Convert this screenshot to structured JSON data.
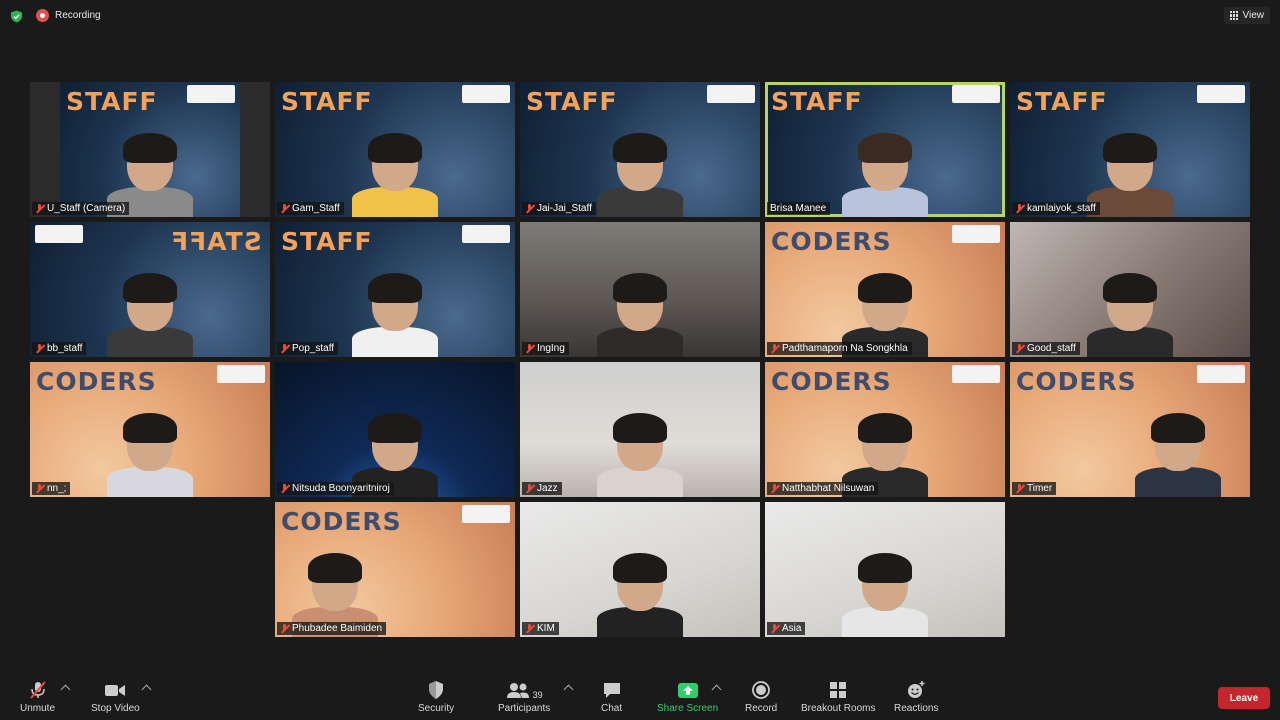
{
  "topbar": {
    "recording_label": "Recording",
    "view_label": "View"
  },
  "participants": [
    {
      "name": "U_Staff (Camera)",
      "muted": true,
      "background": "staff"
    },
    {
      "name": "Gam_Staff",
      "muted": true,
      "background": "staff"
    },
    {
      "name": "Jai-Jai_Staff",
      "muted": true,
      "background": "staff"
    },
    {
      "name": "Brisa Manee",
      "muted": false,
      "background": "staff",
      "active_speaker": true
    },
    {
      "name": "kamlaiyok_staff",
      "muted": true,
      "background": "staff"
    },
    {
      "name": "bb_staff",
      "muted": true,
      "background": "staff"
    },
    {
      "name": "Pop_staff",
      "muted": true,
      "background": "staff"
    },
    {
      "name": "IngIng",
      "muted": true,
      "background": "room"
    },
    {
      "name": "Padthamaporn Na Songkhla",
      "muted": true,
      "background": "coders"
    },
    {
      "name": "Good_staff",
      "muted": true,
      "background": "room"
    },
    {
      "name": "nn_;",
      "muted": true,
      "background": "coders"
    },
    {
      "name": "Nitsuda Boonyaritniroj",
      "muted": true,
      "background": "space"
    },
    {
      "name": "Jazz",
      "muted": true,
      "background": "room"
    },
    {
      "name": "Natthabhat Nilsuwan",
      "muted": true,
      "background": "coders"
    },
    {
      "name": "Timer",
      "muted": true,
      "background": "coders"
    },
    {
      "name": "Phubadee Baimiden",
      "muted": true,
      "background": "coders"
    },
    {
      "name": "KIM",
      "muted": true,
      "background": "room"
    },
    {
      "name": "Asia",
      "muted": true,
      "background": "room"
    }
  ],
  "banners": {
    "staff": "STAFF",
    "coders": "CODERS"
  },
  "toolbar": {
    "unmute_label": "Unmute",
    "stop_video_label": "Stop Video",
    "security_label": "Security",
    "participants_label": "Participants",
    "participants_count": "39",
    "chat_label": "Chat",
    "share_screen_label": "Share Screen",
    "record_label": "Record",
    "breakout_rooms_label": "Breakout Rooms",
    "reactions_label": "Reactions",
    "leave_label": "Leave"
  },
  "colors": {
    "share_screen": "#2fd06a",
    "leave": "#c4262e",
    "active_speaker_outline": "#b7d36b",
    "muted_icon": "#e74c3c"
  }
}
